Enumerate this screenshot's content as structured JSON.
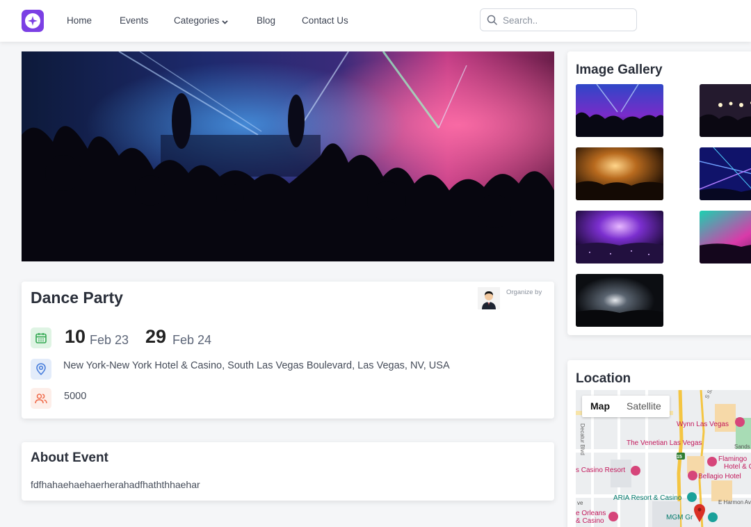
{
  "nav": {
    "logo_alt": "logo",
    "items": [
      "Home",
      "Events",
      "Categories",
      "Blog",
      "Contact Us"
    ],
    "search_placeholder": "Search.."
  },
  "event": {
    "title": "Dance Party",
    "organizer_label": "Organize by",
    "start_day": "10",
    "start_month_year": "Feb 23",
    "end_day": "29",
    "end_month_year": "Feb 24",
    "address": "New York-New York Hotel & Casino, South Las Vegas Boulevard, Las Vegas, NV, USA",
    "capacity": "5000"
  },
  "about": {
    "title": "About Event",
    "text": "fdfhahaehaehaerherahadfhaththhaehar"
  },
  "gallery": {
    "title": "Image Gallery"
  },
  "location": {
    "title": "Location",
    "map_tab": "Map",
    "satellite_tab": "Satellite",
    "labels": {
      "wynn": "Wynn Las Vegas",
      "venetian": "The Venetian Las Vegas",
      "sands": "Sands",
      "flamingo1": "Flamingo",
      "flamingo2": "Hotel & C",
      "casino_resort": "s Casino Resort",
      "bellagio": "Bellagio Hotel",
      "aria": "ARIA Resort & Casino",
      "harmon": "E Harmon Ave",
      "orleans1": "e Orleans",
      "orleans2": "& Casino",
      "mgm": "MGM Gr",
      "decatur": "Decatur Blvd",
      "sammy": "S Sammy D",
      "i15": "15",
      "tve": "ve"
    }
  },
  "colors": {
    "brand": "#7b3fe4",
    "calendar_green": "#34a853",
    "location_blue": "#4a7fdc",
    "people_red": "#f06a4a",
    "map_pink": "#d6457a",
    "map_teal": "#1aa19a"
  }
}
